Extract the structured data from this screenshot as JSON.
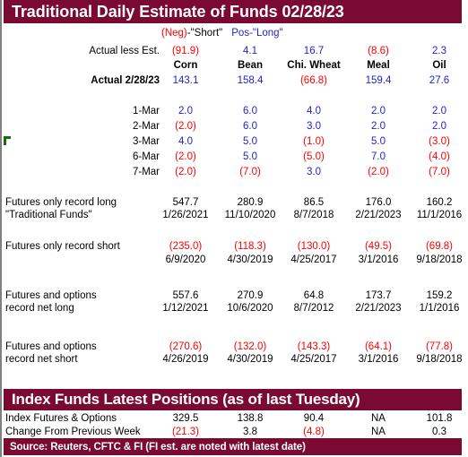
{
  "header": {
    "title": "Traditional Daily Estimate of Funds 02/28/23",
    "index_title": "Index Funds Latest Positions (as of last Tuesday)",
    "source": "Source: Reuters, CFTC & FI (FI est. are noted with latest date)"
  },
  "legend": {
    "neg": "(Neg)",
    "short": "-\"Short\"",
    "pos_long": "Pos-\"Long\""
  },
  "columns": [
    "Corn",
    "Bean",
    "Chi. Wheat",
    "Meal",
    "Oil"
  ],
  "rows": {
    "actual_less_est": {
      "label": "Actual less Est.",
      "values": [
        "(91.9)",
        "4.1",
        "16.7",
        "(8.6)",
        "2.3"
      ],
      "colors": [
        "red",
        "blue",
        "blue",
        "red",
        "blue"
      ]
    },
    "actual_date": {
      "label": "Actual 2/28/23",
      "values": [
        "143.1",
        "158.4",
        "(66.8)",
        "159.4",
        "27.6"
      ],
      "colors": [
        "blue",
        "blue",
        "red",
        "blue",
        "blue"
      ]
    },
    "daily": [
      {
        "date": "1-Mar",
        "values": [
          "2.0",
          "6.0",
          "4.0",
          "2.0",
          "2.0"
        ],
        "colors": [
          "blue",
          "blue",
          "blue",
          "blue",
          "blue"
        ]
      },
      {
        "date": "2-Mar",
        "values": [
          "(2.0)",
          "6.0",
          "3.0",
          "2.0",
          "2.0"
        ],
        "colors": [
          "red",
          "blue",
          "blue",
          "blue",
          "blue"
        ]
      },
      {
        "date": "3-Mar",
        "values": [
          "4.0",
          "5.0",
          "(1.0)",
          "5.0",
          "(3.0)"
        ],
        "colors": [
          "blue",
          "blue",
          "red",
          "blue",
          "red"
        ]
      },
      {
        "date": "6-Mar",
        "values": [
          "(2.0)",
          "5.0",
          "(5.0)",
          "7.0",
          "(4.0)"
        ],
        "colors": [
          "red",
          "blue",
          "red",
          "blue",
          "red"
        ]
      },
      {
        "date": "7-Mar",
        "values": [
          "(2.0)",
          "(7.0)",
          "3.0",
          "(2.0)",
          "(7.0)"
        ],
        "colors": [
          "red",
          "red",
          "blue",
          "red",
          "red"
        ]
      }
    ],
    "futures_record_long": {
      "label_line1": "Futures only record long",
      "label_line2": "\"Traditional Funds\"",
      "values": [
        "547.7",
        "280.9",
        "86.5",
        "176.0",
        "160.2"
      ],
      "dates": [
        "1/26/2021",
        "11/10/2020",
        "8/7/2018",
        "2/21/2023",
        "11/1/2016"
      ],
      "colors": [
        "black",
        "black",
        "black",
        "black",
        "black"
      ]
    },
    "futures_record_short": {
      "label_line1": "Futures only record short",
      "label_line2": "",
      "values": [
        "(235.0)",
        "(118.3)",
        "(130.0)",
        "(49.5)",
        "(69.8)"
      ],
      "dates": [
        "6/9/2020",
        "4/30/2019",
        "4/25/2017",
        "3/1/2016",
        "9/18/2018"
      ],
      "colors": [
        "red",
        "red",
        "red",
        "red",
        "red"
      ]
    },
    "futopt_record_net_long": {
      "label_line1": "Futures and options",
      "label_line2": "record net long",
      "values": [
        "557.6",
        "270.9",
        "64.8",
        "173.7",
        "159.2"
      ],
      "dates": [
        "1/12/2021",
        "10/6/2020",
        "8/7/2012",
        "2/21/2023",
        "1/1/2016"
      ],
      "colors": [
        "black",
        "black",
        "black",
        "black",
        "black"
      ]
    },
    "futopt_record_net_short": {
      "label_line1": "Futures and options",
      "label_line2": "record net short",
      "values": [
        "(270.6)",
        "(132.0)",
        "(143.3)",
        "(64.1)",
        "(77.8)"
      ],
      "dates": [
        "4/26/2019",
        "4/30/2019",
        "4/25/2017",
        "3/1/2016",
        "9/18/2018"
      ],
      "colors": [
        "red",
        "red",
        "red",
        "red",
        "red"
      ]
    },
    "index_futures_options": {
      "label": "Index Futures & Options",
      "values": [
        "329.5",
        "138.8",
        "90.4",
        "NA",
        "101.8"
      ],
      "colors": [
        "black",
        "black",
        "black",
        "black",
        "black"
      ]
    },
    "change_prev_week": {
      "label": "Change From Previous Week",
      "values": [
        "(21.3)",
        "3.8",
        "(4.8)",
        "NA",
        "0.3"
      ],
      "colors": [
        "red",
        "black",
        "red",
        "black",
        "black"
      ]
    }
  },
  "colors": {
    "maroon": "#7A0A32",
    "blue": "#2222CC",
    "red": "#FF0000",
    "green_marker": "#107010"
  }
}
